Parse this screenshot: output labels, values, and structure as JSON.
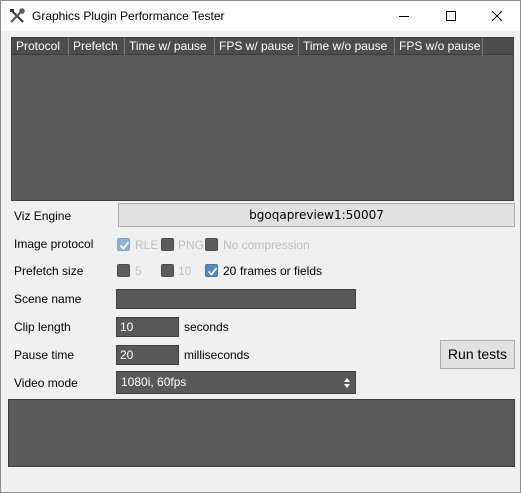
{
  "window": {
    "title": "Graphics Plugin Performance Tester",
    "icon": "tools-icon"
  },
  "grid": {
    "columns": [
      "Protocol",
      "Prefetch",
      "Time w/ pause",
      "FPS w/ pause",
      "Time w/o pause",
      "FPS w/o pause"
    ],
    "rows": []
  },
  "form": {
    "viz_engine_label": "Viz Engine",
    "viz_engine_value": "bgoqapreview1:50007",
    "image_protocol_label": "Image protocol",
    "protocol_options": [
      {
        "label": "RLE",
        "checked": true,
        "enabled": false
      },
      {
        "label": "PNG",
        "checked": false,
        "enabled": false
      },
      {
        "label": "No compression",
        "checked": false,
        "enabled": false
      }
    ],
    "prefetch_label": "Prefetch size",
    "prefetch_options": [
      {
        "label": "5",
        "checked": false,
        "enabled": false
      },
      {
        "label": "10",
        "checked": false,
        "enabled": false
      },
      {
        "label": "20",
        "checked": true,
        "enabled": true
      }
    ],
    "prefetch_suffix": "frames or fields",
    "scene_name_label": "Scene name",
    "scene_name_value": "",
    "clip_length_label": "Clip length",
    "clip_length_value": "10",
    "clip_length_unit": "seconds",
    "pause_time_label": "Pause time",
    "pause_time_value": "20",
    "pause_time_unit": "milliseconds",
    "video_mode_label": "Video mode",
    "video_mode_value": "1080i, 60fps",
    "run_button": "Run tests"
  },
  "log": {
    "text": ""
  }
}
